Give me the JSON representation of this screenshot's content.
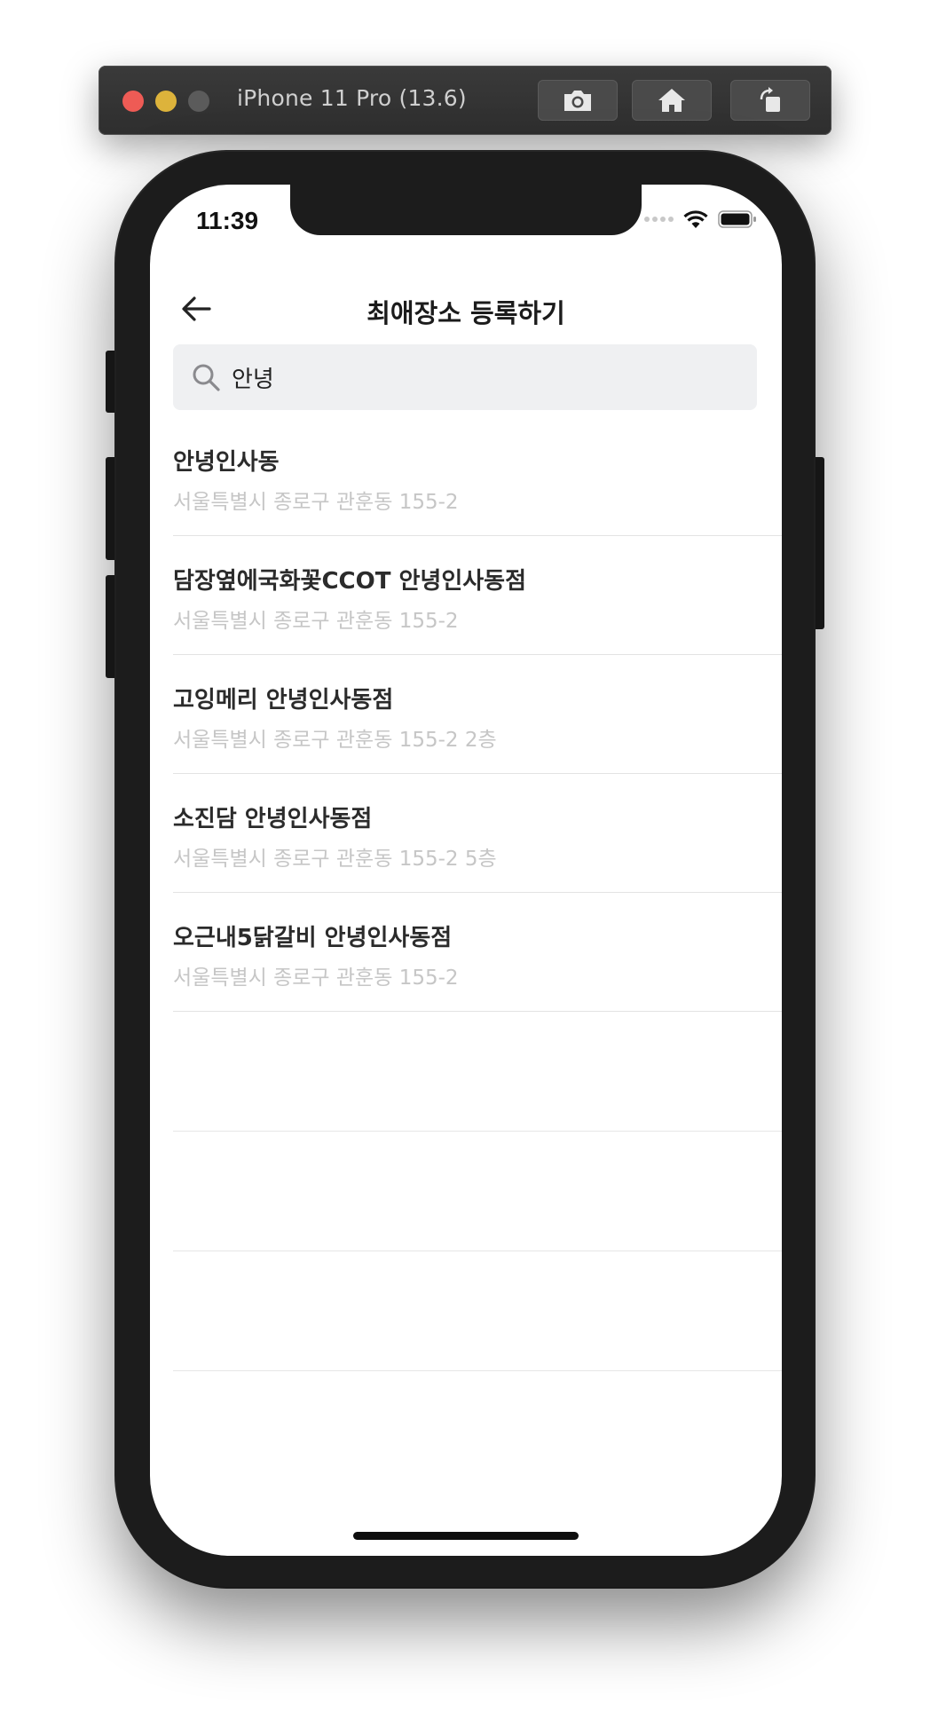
{
  "simulator": {
    "title": "iPhone 11 Pro (13.6)",
    "buttons": [
      {
        "icon": "camera-icon",
        "label": "Screenshot"
      },
      {
        "icon": "home-icon",
        "label": "Home"
      },
      {
        "icon": "rotate-icon",
        "label": "Rotate"
      }
    ]
  },
  "status_bar": {
    "time": "11:39",
    "wifi_icon": "wifi-icon",
    "battery_icon": "battery-icon"
  },
  "nav": {
    "back_icon": "back-arrow-icon",
    "title": "최애장소 등록하기"
  },
  "search": {
    "icon": "search-icon",
    "value": "안녕",
    "background": "#eff0f2"
  },
  "results": [
    {
      "name": "안녕인사동",
      "address": "서울특별시 종로구 관훈동 155-2"
    },
    {
      "name": "담장옆에국화꽃CCOT 안녕인사동점",
      "address": "서울특별시 종로구 관훈동 155-2"
    },
    {
      "name": "고잉메리 안녕인사동점",
      "address": "서울특별시 종로구 관훈동 155-2 2층"
    },
    {
      "name": "소진담 안녕인사동점",
      "address": "서울특별시 종로구 관훈동 155-2 5층"
    },
    {
      "name": "오근내5닭갈비 안녕인사동점",
      "address": "서울특별시 종로구 관훈동 155-2"
    }
  ],
  "colors": {
    "title_text": "#1b1b1b",
    "address_text": "#c6c6c6",
    "divider": "#e3e3e3"
  }
}
